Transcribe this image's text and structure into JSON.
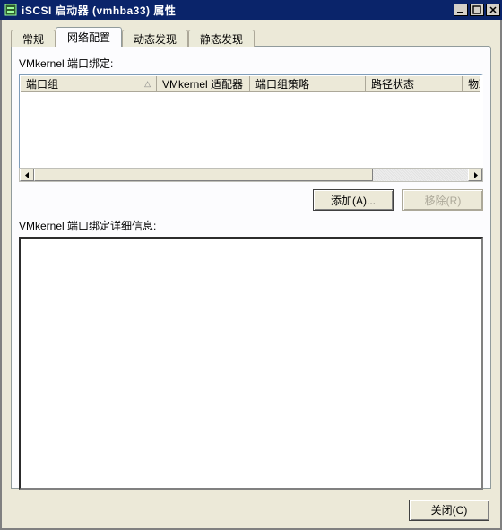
{
  "titlebar": {
    "title": "iSCSI 启动器 (vmhba33) 属性"
  },
  "tabs": {
    "t0": "常规",
    "t1": "网络配置",
    "t2": "动态发现",
    "t3": "静态发现"
  },
  "labels": {
    "bind_label": "VMkernel 端口绑定:",
    "detail_label": "VMkernel 端口绑定详细信息:"
  },
  "columns": {
    "c0": "端口组",
    "c1": "VMkernel 适配器",
    "c2": "端口组策略",
    "c3": "路径状态",
    "c4": "物理"
  },
  "buttons": {
    "add": "添加(A)...",
    "remove": "移除(R)",
    "close": "关闭(C)"
  }
}
